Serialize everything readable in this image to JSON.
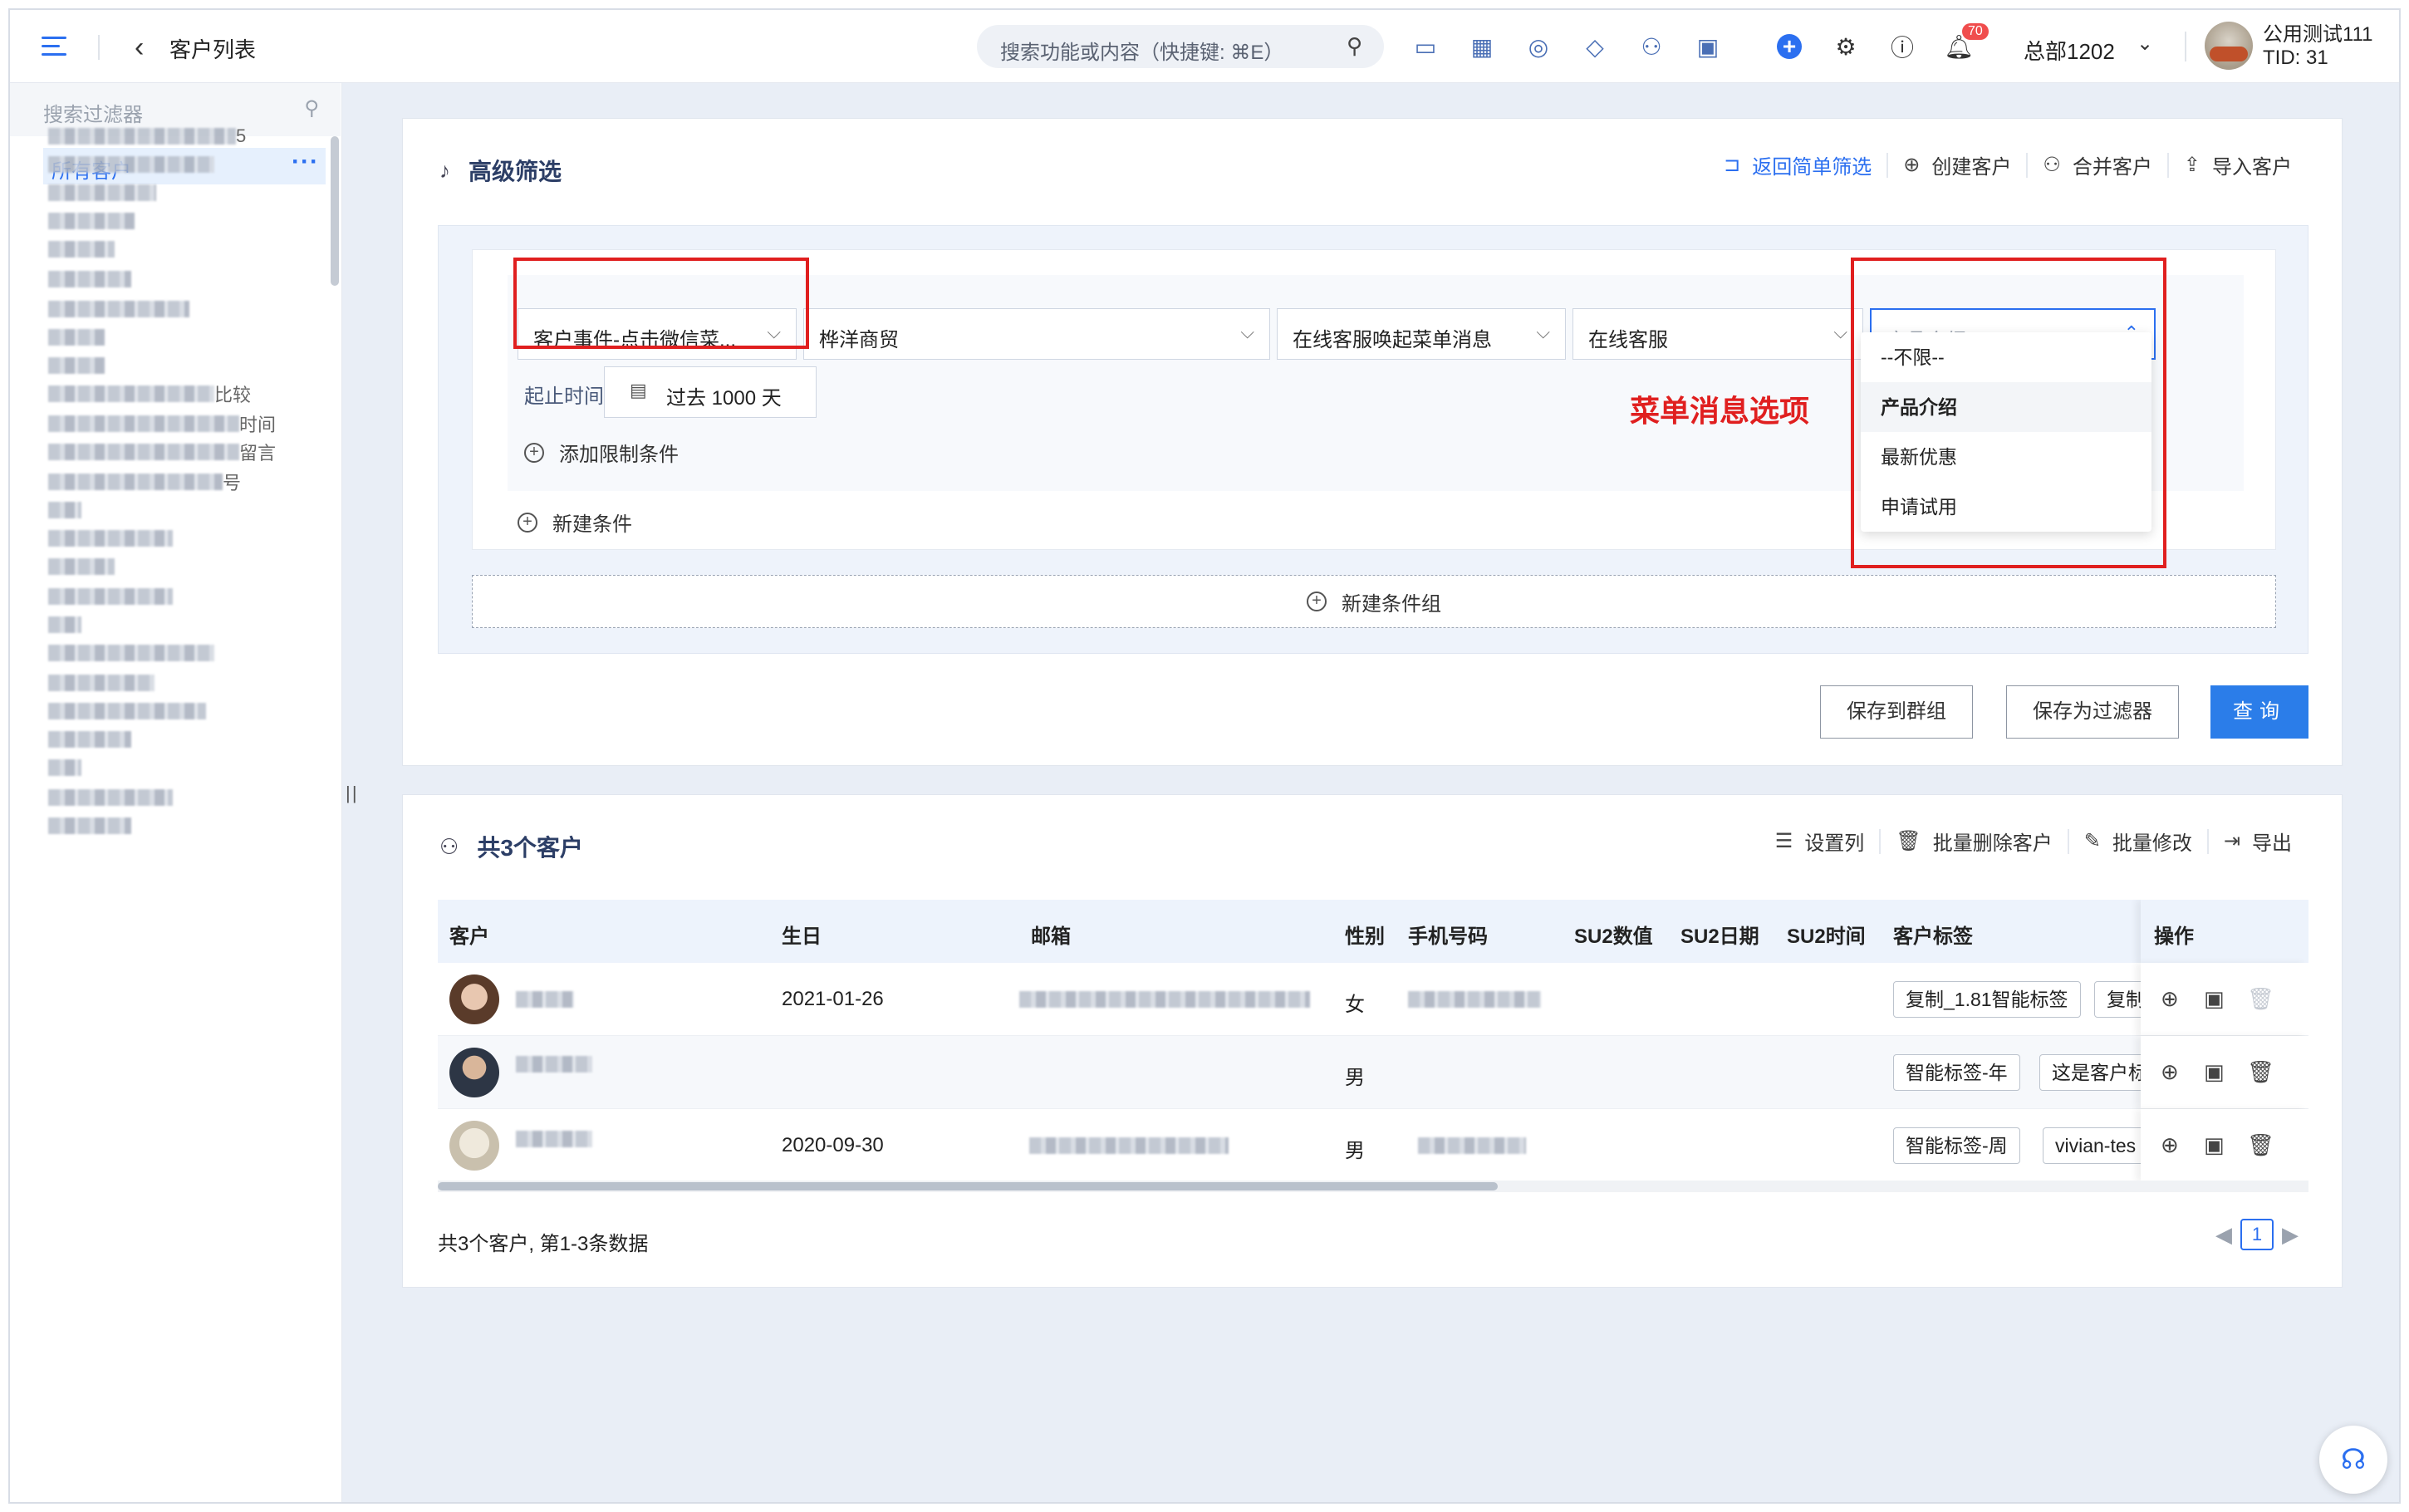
{
  "topbar": {
    "page_title": "客户列表",
    "search_placeholder": "搜索功能或内容（快捷键: ⌘E）",
    "notification_count": "70",
    "org_name": "总部1202",
    "user_name": "公用测试111",
    "tid": "TID: 31"
  },
  "sidebar": {
    "search_placeholder": "搜索过滤器",
    "active_item": "所有客户",
    "items": [
      {
        "suffix": "5"
      },
      {
        "suffix": ""
      },
      {
        "suffix": ""
      },
      {
        "suffix": ""
      },
      {
        "suffix": ""
      },
      {
        "suffix": ""
      },
      {
        "suffix": ""
      },
      {
        "suffix": ""
      },
      {
        "suffix": ""
      },
      {
        "suffix": "比较"
      },
      {
        "suffix": "时间"
      },
      {
        "suffix": "留言"
      },
      {
        "suffix": "号"
      },
      {
        "suffix": ""
      },
      {
        "suffix": ""
      },
      {
        "suffix": ""
      },
      {
        "suffix": ""
      },
      {
        "suffix": ""
      },
      {
        "suffix": ""
      },
      {
        "suffix": ""
      },
      {
        "suffix": ""
      },
      {
        "suffix": ""
      },
      {
        "suffix": ""
      },
      {
        "suffix": ""
      },
      {
        "suffix": ""
      }
    ]
  },
  "filter_panel": {
    "title": "高级筛选",
    "actions": {
      "back_simple": "返回简单筛选",
      "create": "创建客户",
      "merge": "合并客户",
      "import": "导入客户"
    },
    "condition": {
      "event_select": "客户事件-点击微信菜...",
      "account_select": "桦洋商贸",
      "event_type_select": "在线客服唤起菜单消息",
      "channel_select": "在线客服",
      "menu_select_placeholder": "产品介绍",
      "time_label": "起止时间",
      "date_range": "过去 1000 天",
      "add_limit": "添加限制条件"
    },
    "dropdown_options": [
      "--不限--",
      "产品介绍",
      "最新优惠",
      "申请试用"
    ],
    "dropdown_active_index": 1,
    "annotation": "菜单消息选项",
    "new_condition": "新建条件",
    "new_condition_group": "新建条件组",
    "buttons": {
      "save_group": "保存到群组",
      "save_filter": "保存为过滤器",
      "query": "查询"
    }
  },
  "result_panel": {
    "title": "共3个客户",
    "actions": {
      "set_columns": "设置列",
      "batch_delete": "批量删除客户",
      "batch_edit": "批量修改",
      "export": "导出"
    },
    "columns": [
      "客户",
      "生日",
      "邮箱",
      "性别",
      "手机号码",
      "SU2数值",
      "SU2日期",
      "SU2时间",
      "客户标签",
      "操作"
    ],
    "rows": [
      {
        "birthday": "2021-01-26",
        "gender": "女",
        "tags": [
          "复制_1.81智能标签",
          "复制"
        ]
      },
      {
        "birthday": "",
        "gender": "男",
        "tags": [
          "智能标签-年",
          "这是客户标"
        ]
      },
      {
        "birthday": "2020-09-30",
        "gender": "男",
        "tags": [
          "智能标签-周",
          "vivian-tes"
        ]
      }
    ],
    "summary": "共3个客户, 第1-3条数据",
    "current_page": "1"
  }
}
